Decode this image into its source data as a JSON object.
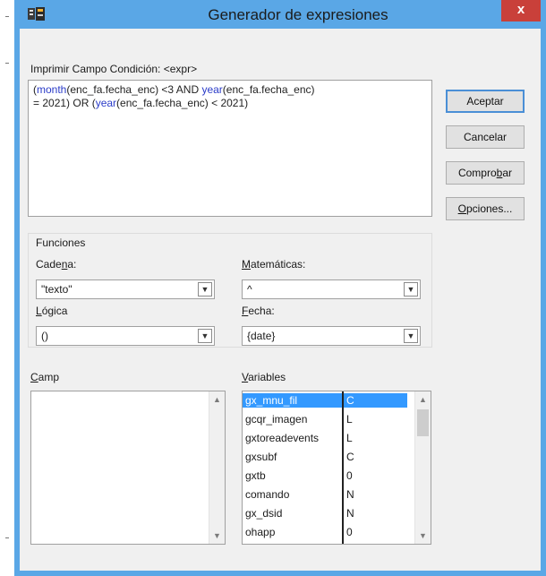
{
  "window": {
    "title": "Generador de expresiones",
    "close_label": "x"
  },
  "expression": {
    "label": "Imprimir Campo Condición: <expr>",
    "line1": [
      {
        "text": "(",
        "kw": false
      },
      {
        "text": "month",
        "kw": true
      },
      {
        "text": "(enc_fa.fecha_enc) <3 AND ",
        "kw": false
      },
      {
        "text": "year",
        "kw": true
      },
      {
        "text": "(enc_fa.fecha_enc)",
        "kw": false
      }
    ],
    "line2": [
      {
        "text": "= 2021)  OR (",
        "kw": false
      },
      {
        "text": "year",
        "kw": true
      },
      {
        "text": "(enc_fa.fecha_enc) < 2021)",
        "kw": false
      }
    ]
  },
  "buttons": {
    "accept": "Aceptar",
    "cancel": "Cancelar",
    "check_pre": "Compro",
    "check_u": "b",
    "check_post": "ar",
    "options_u": "O",
    "options_post": "pciones..."
  },
  "functions": {
    "group_label": "Funciones",
    "cadena": {
      "pre": "Cade",
      "u": "n",
      "post": "a:",
      "value": "\"texto\""
    },
    "matematicas": {
      "pre": "",
      "u": "M",
      "post": "atemáticas:",
      "value": "^"
    },
    "logica": {
      "pre": "",
      "u": "L",
      "post": "ógica",
      "value": "()"
    },
    "fecha": {
      "pre": "",
      "u": "F",
      "post": "echa:",
      "value": "{date}"
    }
  },
  "campo": {
    "pre": "",
    "u": "C",
    "post": "amp"
  },
  "variables": {
    "label_pre": "",
    "label_u": "V",
    "label_post": "ariables",
    "rows": [
      {
        "name": "gx_mnu_fil",
        "type": "C",
        "selected": true
      },
      {
        "name": "gcqr_imagen",
        "type": "L",
        "selected": false
      },
      {
        "name": "gxtoreadevents",
        "type": "L",
        "selected": false
      },
      {
        "name": "gxsubf",
        "type": "C",
        "selected": false
      },
      {
        "name": "gxtb",
        "type": "0",
        "selected": false
      },
      {
        "name": "comando",
        "type": "N",
        "selected": false
      },
      {
        "name": "gx_dsid",
        "type": "N",
        "selected": false
      },
      {
        "name": "ohapp",
        "type": "0",
        "selected": false
      }
    ]
  },
  "icons": {
    "app": "app-icon",
    "close": "close-icon",
    "dropdown": "chevron-down-icon",
    "scroll_up": "scroll-up-arrow-icon",
    "scroll_down": "scroll-down-arrow-icon"
  },
  "colors": {
    "title_bar": "#5aa7e6",
    "close": "#c9403a",
    "selection": "#3399ff",
    "keyword": "#2b3cc8"
  }
}
